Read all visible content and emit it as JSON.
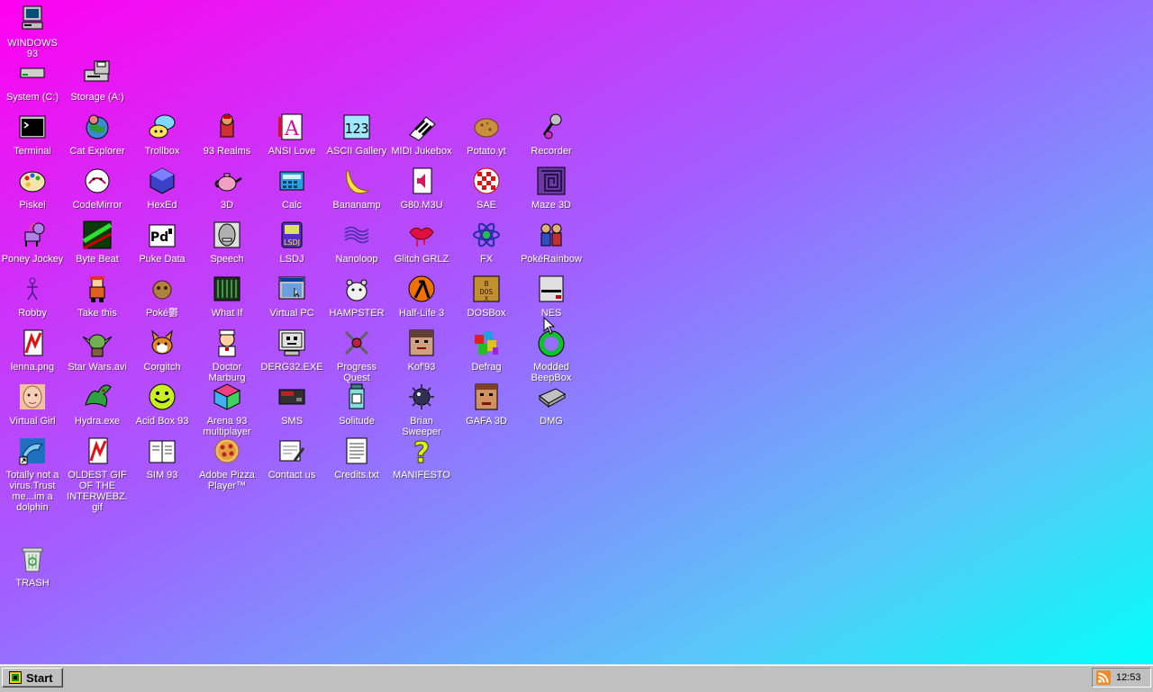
{
  "desktop": {
    "icons": [
      {
        "label": "WINDOWS 93",
        "icon": "computer-icon"
      },
      {
        "label": "System (C:)",
        "icon": "hard-drive-icon"
      },
      {
        "label": "Storage (A:)",
        "icon": "floppy-drive-icon"
      },
      {
        "label": "Terminal",
        "icon": "terminal-icon"
      },
      {
        "label": "Cat Explorer",
        "icon": "cat-globe-icon"
      },
      {
        "label": "Trollbox",
        "icon": "chat-bubble-icon"
      },
      {
        "label": "93 Realms",
        "icon": "knight-icon"
      },
      {
        "label": "ANSI Love",
        "icon": "letter-a-icon"
      },
      {
        "label": "ASCII Gallery",
        "icon": "ascii-numbers-icon"
      },
      {
        "label": "MIDI Jukebox",
        "icon": "piano-keys-icon"
      },
      {
        "label": "Potato.yt",
        "icon": "potato-icon"
      },
      {
        "label": "Recorder",
        "icon": "microphone-icon"
      },
      {
        "label": "Piskel",
        "icon": "palette-icon"
      },
      {
        "label": "CodeMirror",
        "icon": "cat-code-icon"
      },
      {
        "label": "HexEd",
        "icon": "hex-cube-icon"
      },
      {
        "label": "3D",
        "icon": "teapot-icon"
      },
      {
        "label": "Calc",
        "icon": "calculator-icon"
      },
      {
        "label": "Bananamp",
        "icon": "banana-icon"
      },
      {
        "label": "G80.M3U",
        "icon": "speaker-file-icon"
      },
      {
        "label": "SAE",
        "icon": "checkered-ball-icon"
      },
      {
        "label": "Maze 3D",
        "icon": "maze-icon"
      },
      {
        "label": "Poney Jockey",
        "icon": "pony-icon"
      },
      {
        "label": "Byte Beat",
        "icon": "green-wave-icon"
      },
      {
        "label": "Puke Data",
        "icon": "pd-icon"
      },
      {
        "label": "Speech",
        "icon": "speech-face-icon"
      },
      {
        "label": "LSDJ",
        "icon": "gameboy-icon"
      },
      {
        "label": "Nanoloop",
        "icon": "wave-lines-icon"
      },
      {
        "label": "Glitch GRLZ",
        "icon": "lips-icon"
      },
      {
        "label": "FX",
        "icon": "atom-icon"
      },
      {
        "label": "PokéRainbow",
        "icon": "trainers-icon"
      },
      {
        "label": "Robby",
        "icon": "stick-figure-icon"
      },
      {
        "label": "Take this",
        "icon": "pixel-man-icon"
      },
      {
        "label": "Poké鬱",
        "icon": "poke-ball-icon"
      },
      {
        "label": "What If",
        "icon": "matrix-screen-icon"
      },
      {
        "label": "Virtual PC",
        "icon": "window-icon"
      },
      {
        "label": "HAMPSTER",
        "icon": "hamster-icon"
      },
      {
        "label": "Half-Life 3",
        "icon": "lambda-icon"
      },
      {
        "label": "DOSBox",
        "icon": "dosbox-icon"
      },
      {
        "label": "NES",
        "icon": "nes-console-icon"
      },
      {
        "label": "lenna.png",
        "icon": "image-file-icon"
      },
      {
        "label": "Star Wars.avi",
        "icon": "yoda-icon"
      },
      {
        "label": "Corgitch",
        "icon": "corgi-icon"
      },
      {
        "label": "Doctor Marburg",
        "icon": "doctor-icon"
      },
      {
        "label": "DERG32.EXE",
        "icon": "robot-monitor-icon"
      },
      {
        "label": "Progress Quest",
        "icon": "crossed-swords-icon"
      },
      {
        "label": "Kof'93",
        "icon": "fighter-face-icon"
      },
      {
        "label": "Defrag",
        "icon": "defrag-blocks-icon"
      },
      {
        "label": "Modded BeepBox",
        "icon": "green-ring-icon"
      },
      {
        "label": "Virtual Girl",
        "icon": "girl-face-icon"
      },
      {
        "label": "Hydra.exe",
        "icon": "dragon-icon"
      },
      {
        "label": "Acid Box 93",
        "icon": "smiley-icon"
      },
      {
        "label": "Arena 93 multiplayer",
        "icon": "cube-icon"
      },
      {
        "label": "SMS",
        "icon": "sega-console-icon"
      },
      {
        "label": "Solitude",
        "icon": "jar-icon"
      },
      {
        "label": "Brian Sweeper",
        "icon": "mine-icon"
      },
      {
        "label": "GAFA 3D",
        "icon": "doom-face-icon"
      },
      {
        "label": "DMG",
        "icon": "cartridge-icon"
      },
      {
        "label": "Totally not a virus.Trust me...im a dolphin",
        "icon": "dolphin-icon"
      },
      {
        "label": "OLDEST GIF OF THE INTERWEBZ.gif",
        "icon": "gif-file-icon"
      },
      {
        "label": "SIM 93",
        "icon": "book-icon"
      },
      {
        "label": "Adobe Pizza Player™",
        "icon": "pizza-icon"
      },
      {
        "label": "Contact us",
        "icon": "letter-pen-icon"
      },
      {
        "label": "Credits.txt",
        "icon": "text-file-icon"
      },
      {
        "label": "MANIFESTO",
        "icon": "question-mark-icon"
      },
      {
        "label": "TRASH",
        "icon": "trash-icon"
      }
    ]
  },
  "taskbar": {
    "start_label": "Start",
    "clock": "12:53"
  },
  "colors": {
    "gradient_start": "#ff00f0",
    "gradient_end": "#00fff8",
    "taskbar": "#c0c0c0"
  }
}
